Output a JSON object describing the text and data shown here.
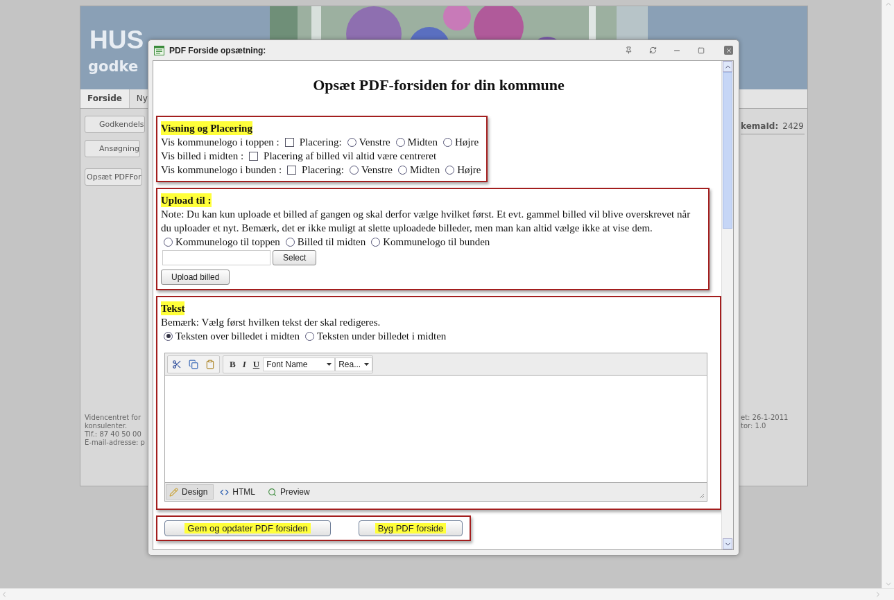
{
  "background_page": {
    "logo_big": "HUS",
    "logo_small": "godke",
    "nav": [
      {
        "label": "Forside",
        "selected": true
      },
      {
        "label": "Ny",
        "selected": false
      }
    ],
    "side_buttons": [
      "Godkendels",
      "Ansøgning",
      "Opsæt PDFFor"
    ],
    "footer_left": [
      "Videncentret for",
      "konsulenter.",
      "Tlf.: 87 40 50 00",
      "E-mail-adresse: p"
    ],
    "id_label": "kemaId:",
    "id_value": "2429",
    "footer_right": [
      "et: 26-1-2011",
      "tor: 1.0"
    ]
  },
  "dialog": {
    "title": "PDF Forside opsætning:",
    "heading": "Opsæt PDF-forsiden for din kommune",
    "display_section": {
      "title": "Visning og Placering",
      "rows": [
        {
          "label": "Vis kommunelogo i toppen :",
          "checked": false,
          "checkbox_label": "Placering:",
          "radios": [
            {
              "label": "Venstre",
              "selected": false
            },
            {
              "label": "Midten",
              "selected": false
            },
            {
              "label": "Højre",
              "selected": false
            }
          ]
        },
        {
          "label": "Vis billed i midten :",
          "checked": false,
          "checkbox_label": "Placering af billed vil altid være centreret"
        },
        {
          "label": "Vis kommunelogo i bunden :",
          "checked": false,
          "checkbox_label": "Placering:",
          "radios": [
            {
              "label": "Venstre",
              "selected": false
            },
            {
              "label": "Midten",
              "selected": false
            },
            {
              "label": "Højre",
              "selected": false
            }
          ]
        }
      ]
    },
    "upload_section": {
      "title": "Upload til :",
      "note": "Note: Du kan kun uploade et billed af gangen og skal derfor vælge hvilket først. Et evt. gammel billed vil blive overskrevet når du uploader et nyt. Bemærk, det er ikke muligt at slette uploadede billeder, men man kan altid vælge ikke at vise dem.",
      "targets": [
        {
          "label": "Kommunelogo til toppen",
          "selected": false
        },
        {
          "label": "Billed til midten",
          "selected": false
        },
        {
          "label": "Kommunelogo til bunden",
          "selected": false
        }
      ],
      "select_button": "Select",
      "upload_button": "Upload billed"
    },
    "text_section": {
      "title": "Tekst",
      "note": "Bemærk: Vælg først hvilken tekst der skal redigeres.",
      "targets": [
        {
          "label": "Teksten over billedet i midten",
          "selected": true
        },
        {
          "label": "Teksten under billedet i midten",
          "selected": false
        }
      ],
      "editor": {
        "bold": "B",
        "italic": "I",
        "underline": "U",
        "font_name": "Font Name",
        "font_size": "Rea...",
        "modes": [
          {
            "label": "Design",
            "selected": true
          },
          {
            "label": "HTML",
            "selected": false
          },
          {
            "label": "Preview",
            "selected": false
          }
        ]
      }
    },
    "buttons": [
      "Gem og opdater PDF forsiden",
      "Byg PDF forside"
    ]
  }
}
